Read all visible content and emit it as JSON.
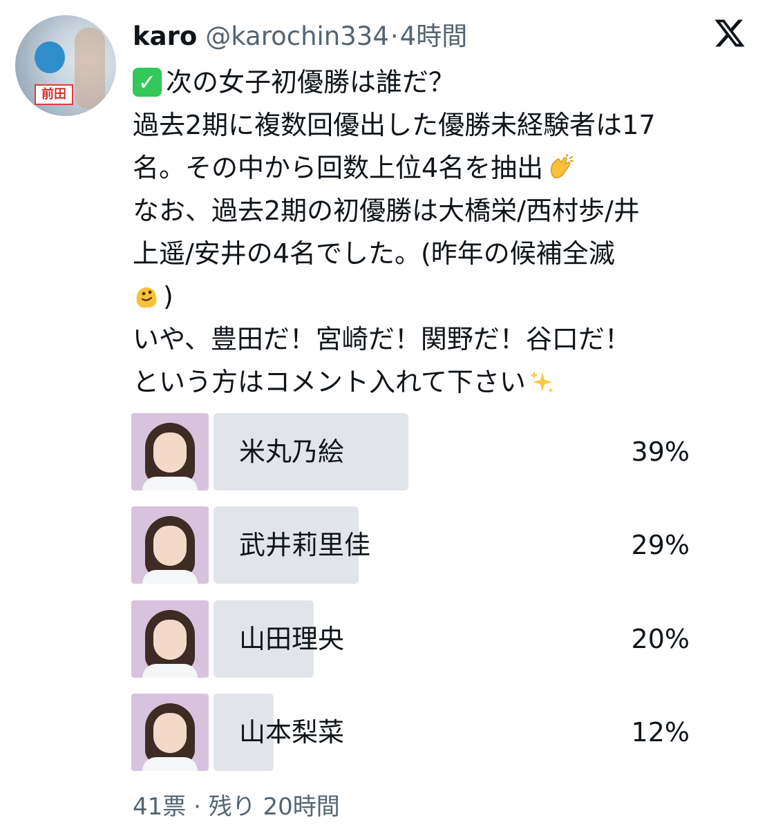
{
  "tweet": {
    "author": {
      "name": "karo",
      "handle": "@karochin334",
      "separator": "·",
      "time": "4時間",
      "avatar_tag": "前田"
    },
    "logo": "x-logo-icon",
    "lines": [
      "次の女子初優勝は誰だ？",
      "過去2期に複数回優出した優勝未経験者は17",
      "名。その中から回数上位4名を抽出",
      "なお、過去2期の初優勝は大橋栄/西村歩/井",
      "上遥/安井の4名でした。(昨年の候補全滅",
      ")",
      "いや、豊田だ！宮崎だ！関野だ！谷口だ！",
      "という方はコメント入れて下さい"
    ],
    "icons": {
      "check": "check-mark-button-icon",
      "clap": "clapping-hands-icon",
      "melting": "melting-face-icon",
      "sparkles": "sparkles-icon"
    }
  },
  "poll": {
    "options": [
      {
        "label": "米丸乃絵",
        "percent_text": "39%",
        "percent": 39
      },
      {
        "label": "武井莉里佳",
        "percent_text": "29%",
        "percent": 29
      },
      {
        "label": "山田理央",
        "percent_text": "20%",
        "percent": 20
      },
      {
        "label": "山本梨菜",
        "percent_text": "12%",
        "percent": 12
      }
    ],
    "votes": "41票",
    "separator": "·",
    "remaining": "残り 20時間"
  },
  "colors": {
    "bar": "#e1e5e9",
    "secondary_text": "#536471",
    "photo_bg": "#d8c3de"
  }
}
